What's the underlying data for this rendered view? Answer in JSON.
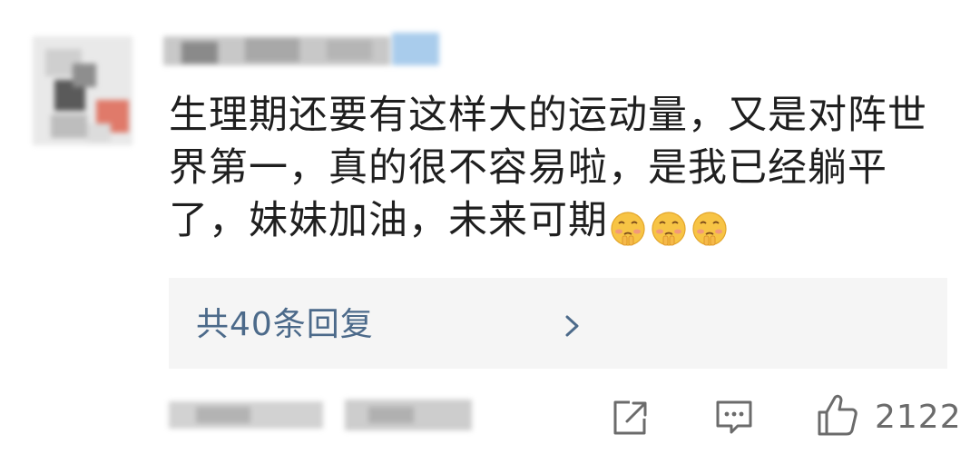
{
  "comment": {
    "text": "生理期还要有这样大的运动量，又是对阵世界第一，真的很不容易啦，是我已经躺平了，妹妹加油，未来可期",
    "emojis": [
      "pleading-face",
      "pleading-face",
      "pleading-face"
    ]
  },
  "replies": {
    "label": "共40条回复"
  },
  "actions": {
    "like_count": "2122"
  },
  "colors": {
    "text": "#1f1f1f",
    "reply_link": "#4c6a8a",
    "reply_bg": "#f5f5f5",
    "icon": "#6b6b6b"
  }
}
